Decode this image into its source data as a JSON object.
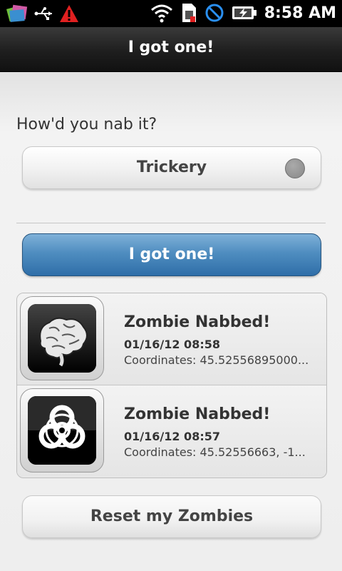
{
  "status_bar": {
    "time": "8:58 AM",
    "icons": [
      "app-icon",
      "usb-icon",
      "warning-icon",
      "wifi-icon",
      "sim-icon",
      "no-signal-icon",
      "battery-charging-icon"
    ]
  },
  "header": {
    "title": "I got one!"
  },
  "form": {
    "prompt": "How'd you nab it?",
    "method_selected": "Trickery",
    "submit_label": "I got one!"
  },
  "list": {
    "items": [
      {
        "icon": "brain-icon",
        "title": "Zombie Nabbed!",
        "date": "01/16/12 08:58",
        "coords": "Coordinates: 45.52556895000..."
      },
      {
        "icon": "biohazard-icon",
        "title": "Zombie Nabbed!",
        "date": "01/16/12 08:57",
        "coords": "Coordinates: 45.52556663, -1..."
      }
    ]
  },
  "footer": {
    "reset_label": "Reset my Zombies"
  },
  "colors": {
    "primary": "#3f80b8",
    "header": "#1e1e1e",
    "background": "#ececec"
  }
}
